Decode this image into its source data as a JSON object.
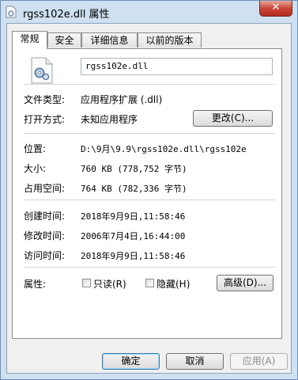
{
  "window": {
    "title": "rgss102e.dll 属性",
    "close_symbol": "✕"
  },
  "tabs": [
    {
      "label": "常规",
      "active": true
    },
    {
      "label": "安全",
      "active": false
    },
    {
      "label": "详细信息",
      "active": false
    },
    {
      "label": "以前的版本",
      "active": false
    }
  ],
  "general": {
    "file_name": "rgss102e.dll",
    "file_type_label": "文件类型:",
    "file_type_value": "应用程序扩展 (.dll)",
    "open_with_label": "打开方式:",
    "open_with_value": "未知应用程序",
    "change_button": "更改(C)...",
    "location_label": "位置:",
    "location_value": "D:\\9月\\9.9\\rgss102e.dll\\rgss102e",
    "size_label": "大小:",
    "size_value": "760 KB (778,752 字节)",
    "size_on_disk_label": "占用空间:",
    "size_on_disk_value": "764 KB (782,336 字节)",
    "created_label": "创建时间:",
    "created_value": "2018年9月9日,11:58:46",
    "modified_label": "修改时间:",
    "modified_value": "2006年7月4日,16:44:00",
    "accessed_label": "访问时间:",
    "accessed_value": "2018年9月9日,11:58:46",
    "attributes_label": "属性:",
    "readonly_label": "只读(R)",
    "hidden_label": "隐藏(H)",
    "advanced_button": "高级(D)..."
  },
  "footer": {
    "ok": "确定",
    "cancel": "取消",
    "apply": "应用(A)"
  }
}
